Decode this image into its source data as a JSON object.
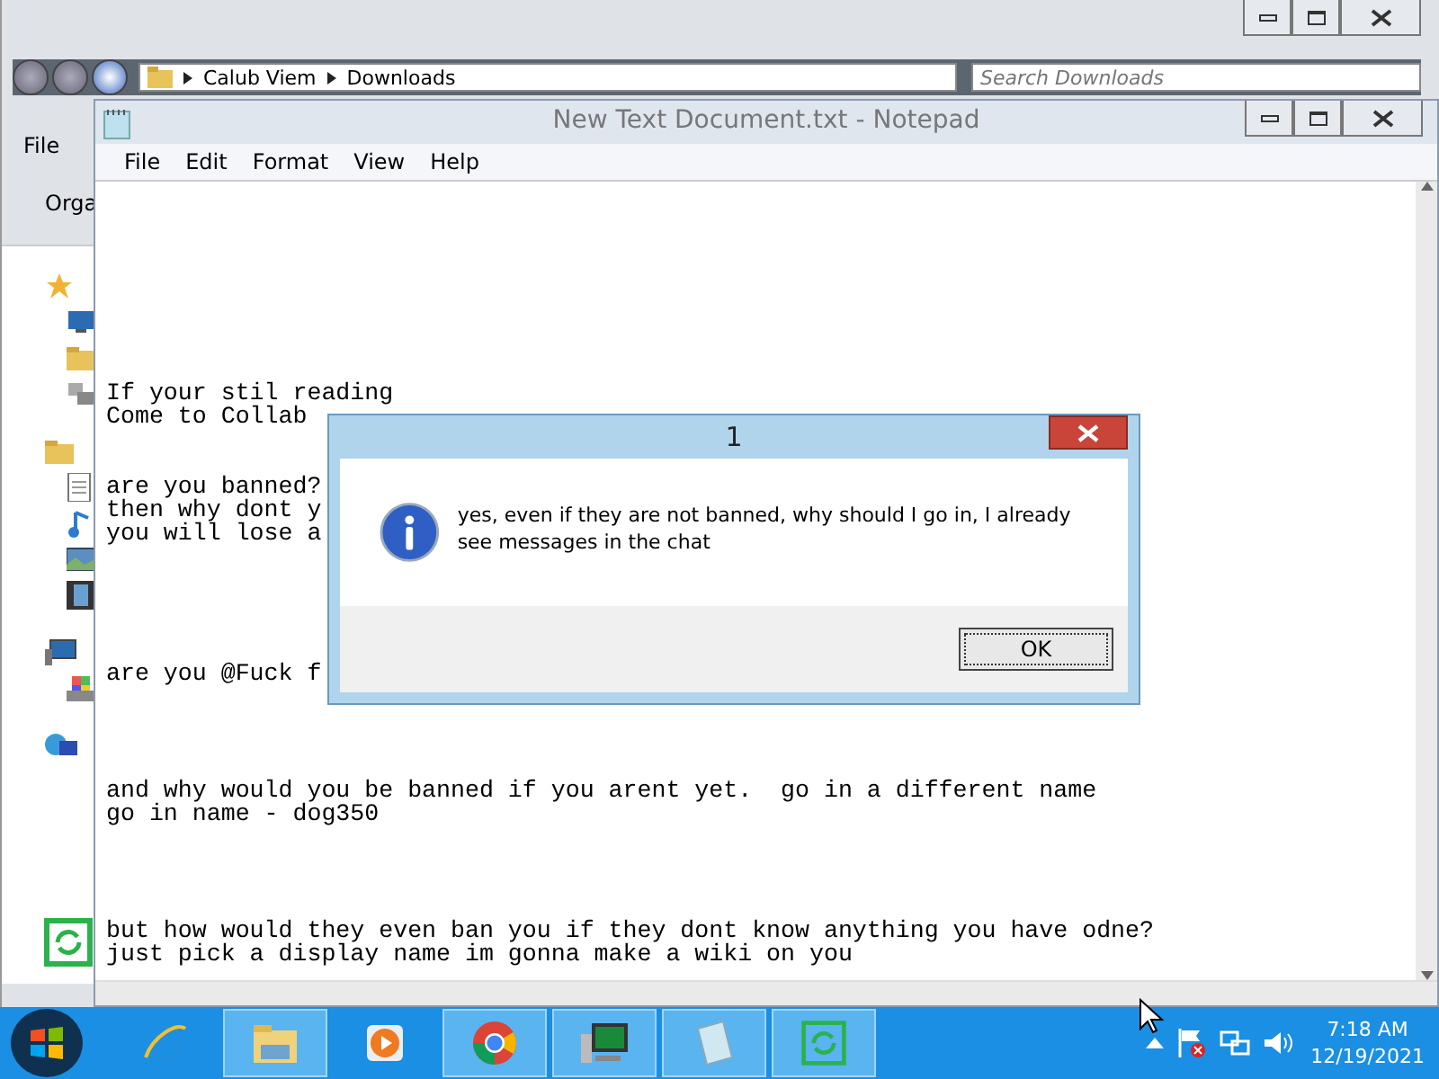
{
  "explorer": {
    "address": [
      "Calub Viem",
      "Downloads"
    ],
    "search": {
      "placeholder": "Search Downloads"
    },
    "menu": [
      "File"
    ],
    "toolbar": [
      "Orga"
    ],
    "sidebar": [
      {
        "kind": "star"
      },
      {
        "kind": "desktop"
      },
      {
        "kind": "folder"
      },
      {
        "kind": "places"
      },
      {
        "kind": "library"
      },
      {
        "kind": "document"
      },
      {
        "kind": "music"
      },
      {
        "kind": "picture"
      },
      {
        "kind": "video"
      },
      {
        "kind": "computer"
      },
      {
        "kind": "drive"
      },
      {
        "kind": "network"
      }
    ]
  },
  "notepad": {
    "title": "New Text Document.txt - Notepad",
    "menu": [
      "File",
      "Edit",
      "Format",
      "View",
      "Help"
    ],
    "paragraphs": [
      [
        "If your stil reading",
        "Come to Collab"
      ],
      [
        "are you banned?",
        "then why dont y",
        "you will lose a"
      ],
      [
        "are you @Fuck f"
      ],
      [
        "and why would you be banned if you arent yet.  go in a different name",
        "go in name - dog350"
      ],
      [
        "but how would they even ban you if they dont know anything you have odne?",
        "just pick a display name im gonna make a wiki on you"
      ]
    ]
  },
  "dialog": {
    "title": "1",
    "message": "yes, even if they are not banned, why should I go in, I already see messages in the chat",
    "buttons": [
      "OK"
    ]
  },
  "taskbar": {
    "items": [
      {
        "kind": "ie",
        "running": false
      },
      {
        "kind": "explorer",
        "running": true
      },
      {
        "kind": "media",
        "running": false
      },
      {
        "kind": "chrome",
        "running": true
      },
      {
        "kind": "monitor",
        "running": true
      },
      {
        "kind": "notepad",
        "running": true
      },
      {
        "kind": "sync",
        "running": true
      }
    ],
    "time": "7:18 AM",
    "date": "12/19/2021"
  }
}
